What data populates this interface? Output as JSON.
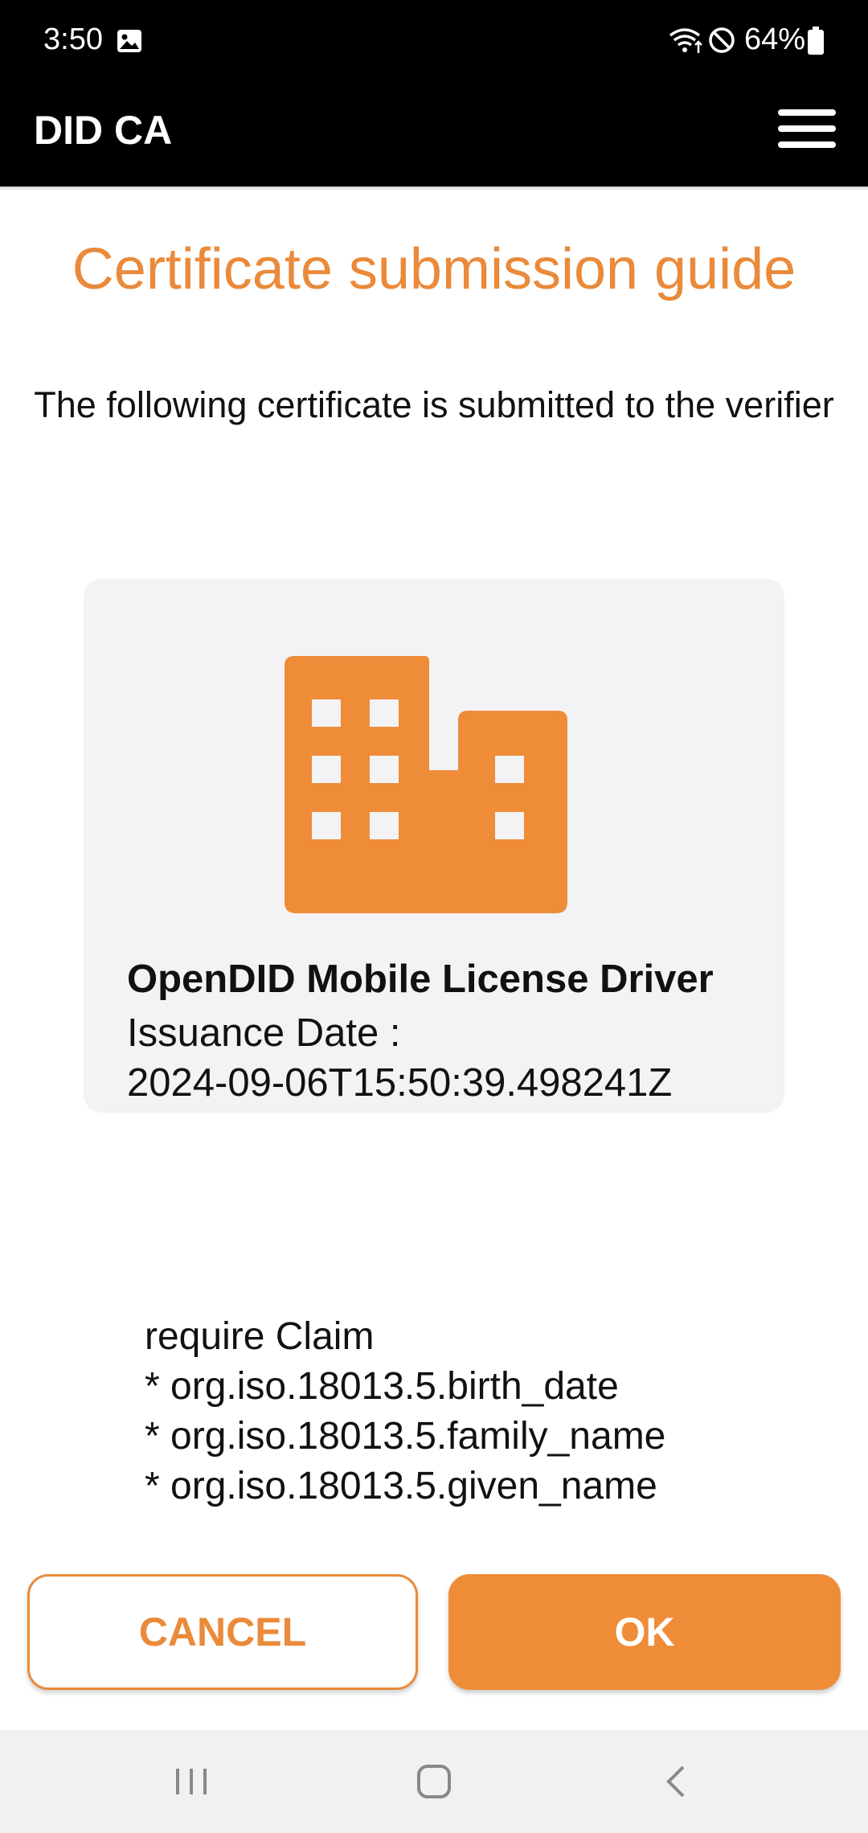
{
  "status_bar": {
    "time": "3:50",
    "battery_percent": "64%",
    "icons": [
      "gallery-icon",
      "wifi-icon",
      "do-not-disturb-icon",
      "battery-icon"
    ]
  },
  "app_bar": {
    "title": "DID CA",
    "menu_icon": "hamburger-menu-icon"
  },
  "page": {
    "title": "Certificate submission guide",
    "subtitle": "The following certificate is submitted to the verifier"
  },
  "certificate": {
    "icon": "building-icon",
    "name": "OpenDID Mobile License Driver",
    "issuance_label": "Issuance Date :",
    "issuance_date": "2024-09-06T15:50:39.498241Z"
  },
  "claims": {
    "header": "require Claim",
    "items": [
      "* org.iso.18013.5.birth_date",
      "* org.iso.18013.5.family_name",
      "* org.iso.18013.5.given_name"
    ]
  },
  "buttons": {
    "cancel_label": "CANCEL",
    "ok_label": "OK"
  },
  "colors": {
    "accent": "#ef8c38",
    "card_background": "#f3f3f5",
    "app_bar": "#000000"
  },
  "nav_bar": {
    "icons": [
      "recent-apps-icon",
      "home-icon",
      "back-icon"
    ]
  }
}
